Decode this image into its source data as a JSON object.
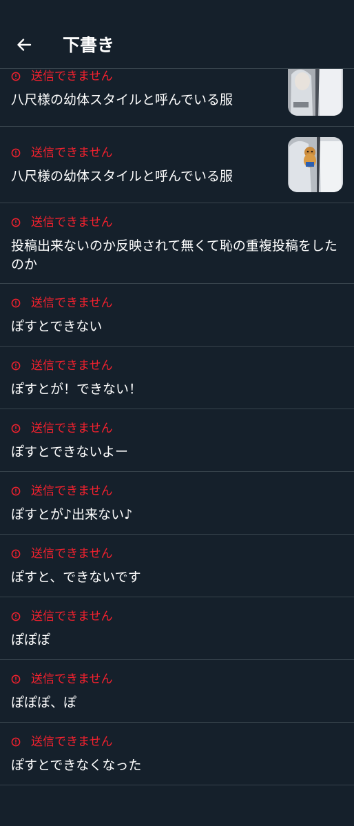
{
  "header": {
    "back_icon": "arrow-left-icon",
    "title": "下書き"
  },
  "status_icon": "alert-circle-icon",
  "colors": {
    "background": "#15202b",
    "divider": "#38444d",
    "error": "#f4212e",
    "text": "#ffffff"
  },
  "drafts": [
    {
      "status": "送信できません",
      "text": "八尺様の幼体スタイルと呼んでいる服",
      "has_image": true
    },
    {
      "status": "送信できません",
      "text": "八尺様の幼体スタイルと呼んでいる服",
      "has_image": true
    },
    {
      "status": "送信できません",
      "text": "投稿出来ないのか反映されて無くて恥の重複投稿をしたのか",
      "has_image": false
    },
    {
      "status": "送信できません",
      "text": "ぽすとできない",
      "has_image": false
    },
    {
      "status": "送信できません",
      "text": "ぽすとが！できない！",
      "has_image": false
    },
    {
      "status": "送信できません",
      "text": "ぽすとできないよー",
      "has_image": false
    },
    {
      "status": "送信できません",
      "text": "ぽすとが♪出来ない♪",
      "has_image": false
    },
    {
      "status": "送信できません",
      "text": "ぽすと、できないです",
      "has_image": false
    },
    {
      "status": "送信できません",
      "text": "ぽぽぽ",
      "has_image": false
    },
    {
      "status": "送信できません",
      "text": "ぽぽぽ、ぽ",
      "has_image": false
    },
    {
      "status": "送信できません",
      "text": "ぽすとできなくなった",
      "has_image": false
    }
  ]
}
